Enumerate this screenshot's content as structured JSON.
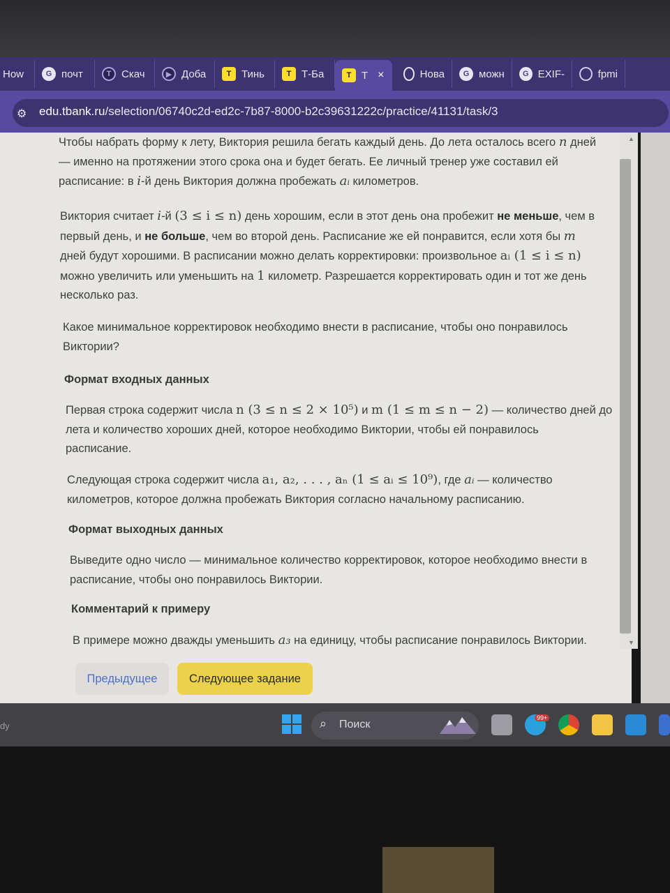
{
  "browser": {
    "tabs": [
      {
        "label": "How",
        "icon": "none"
      },
      {
        "label": "почт",
        "icon": "google-icon"
      },
      {
        "label": "Скач",
        "icon": "tbank-dev-icon"
      },
      {
        "label": "Доба",
        "icon": "play-icon"
      },
      {
        "label": "Тинь",
        "icon": "tbank-icon"
      },
      {
        "label": "Т-Ба",
        "icon": "tbank-icon"
      },
      {
        "label": "Т",
        "icon": "tbank-icon",
        "active": true
      },
      {
        "label": "Нова",
        "icon": "chatgpt-icon"
      },
      {
        "label": "можн",
        "icon": "google-icon"
      },
      {
        "label": "EXIF-",
        "icon": "google-icon"
      },
      {
        "label": "fpmi",
        "icon": "globe-icon"
      }
    ],
    "close_glyph": "×",
    "url_domain": "edu.tbank.ru",
    "url_path": "/selection/06740c2d-ed2c-7b87-8000-b2c39631222c/practice/41131/task/3"
  },
  "task": {
    "p1_a": "Чтобы набрать форму к лету, Виктория решила бегать каждый день. До лета осталось всего",
    "p1_n": "n",
    "p1_b": "дней",
    "p1_line2": "— именно на протяжении этого срока она и будет бегать. Ее личный тренер уже составил ей",
    "p1_line3a": "расписание: в",
    "p1_i": "i",
    "p1_line3b": "-й день Виктория должна пробежать",
    "p1_ai": "aᵢ",
    "p1_line3c": "километров.",
    "p2_l1a": "Виктория считает",
    "p2_l1i": "i",
    "p2_l1b": "-й",
    "p2_l1math": "(3 ≤ i ≤ n)",
    "p2_l1c": "день хорошим, если в этот день она пробежит",
    "p2_l1bold": "не меньше",
    "p2_l1d": ", чем в",
    "p2_l2a": "первый день, и",
    "p2_l2bold": "не больше",
    "p2_l2b": ", чем во второй день. Расписание же ей понравится, если хотя бы",
    "p2_l2m": "m",
    "p2_l3a": "дней будут хорошими. В расписании можно делать корректировки: произвольное",
    "p2_l3math": "aᵢ (1 ≤ i ≤ n)",
    "p2_l4a": "можно увеличить или уменьшить на",
    "p2_l4one": "1",
    "p2_l4b": "километр. Разрешается корректировать один и тот же день",
    "p2_l5": "несколько раз.",
    "question_l1": "Какое минимальное корректировок необходимо внести в расписание, чтобы оно понравилось",
    "question_l2": "Виктории?",
    "input_heading": "Формат входных данных",
    "in1_l1a": "Первая строка содержит числа",
    "in1_l1math1": "n (3 ≤ n ≤ 2 × 10⁵)",
    "in1_l1b": "и",
    "in1_l1math2": "m (1 ≤ m ≤ n − 2)",
    "in1_l1c": "— количество дней до",
    "in1_l2": "лета и количество хороших дней, которое необходимо Виктории, чтобы ей понравилось",
    "in1_l3": "расписание.",
    "in2_l1a": "Следующая строка содержит числа",
    "in2_l1math": "a₁, a₂, . . . , aₙ (1 ≤ aᵢ ≤ 10⁹)",
    "in2_l1b": ", где",
    "in2_l1ai": "aᵢ",
    "in2_l1c": "— количество",
    "in2_l2": "километров, которое должна пробежать Виктория согласно начальному расписанию.",
    "output_heading": "Формат выходных данных",
    "out_l1": "Выведите одно число — минимальное количество корректировок, которое необходимо внести в",
    "out_l2": "расписание, чтобы оно понравилось Виктории.",
    "comment_heading": "Комментарий к примеру",
    "comment_a": "В примере можно дважды уменьшить",
    "comment_math": "a₃",
    "comment_b": "на единицу, чтобы расписание понравилось Виктории."
  },
  "nav": {
    "prev_label": "Предыдущее",
    "next_label": "Следующее задание"
  },
  "taskbar": {
    "status_fragment": "dy",
    "search_label": "Поиск",
    "badge": "99+"
  },
  "colors": {
    "tab_bar": "#3d3370",
    "address_bar": "#574aa0",
    "page_bg": "#e7e6e2",
    "link_blue": "#4f6fc4",
    "next_button": "#ecd24a",
    "taskbar": "#414146"
  }
}
